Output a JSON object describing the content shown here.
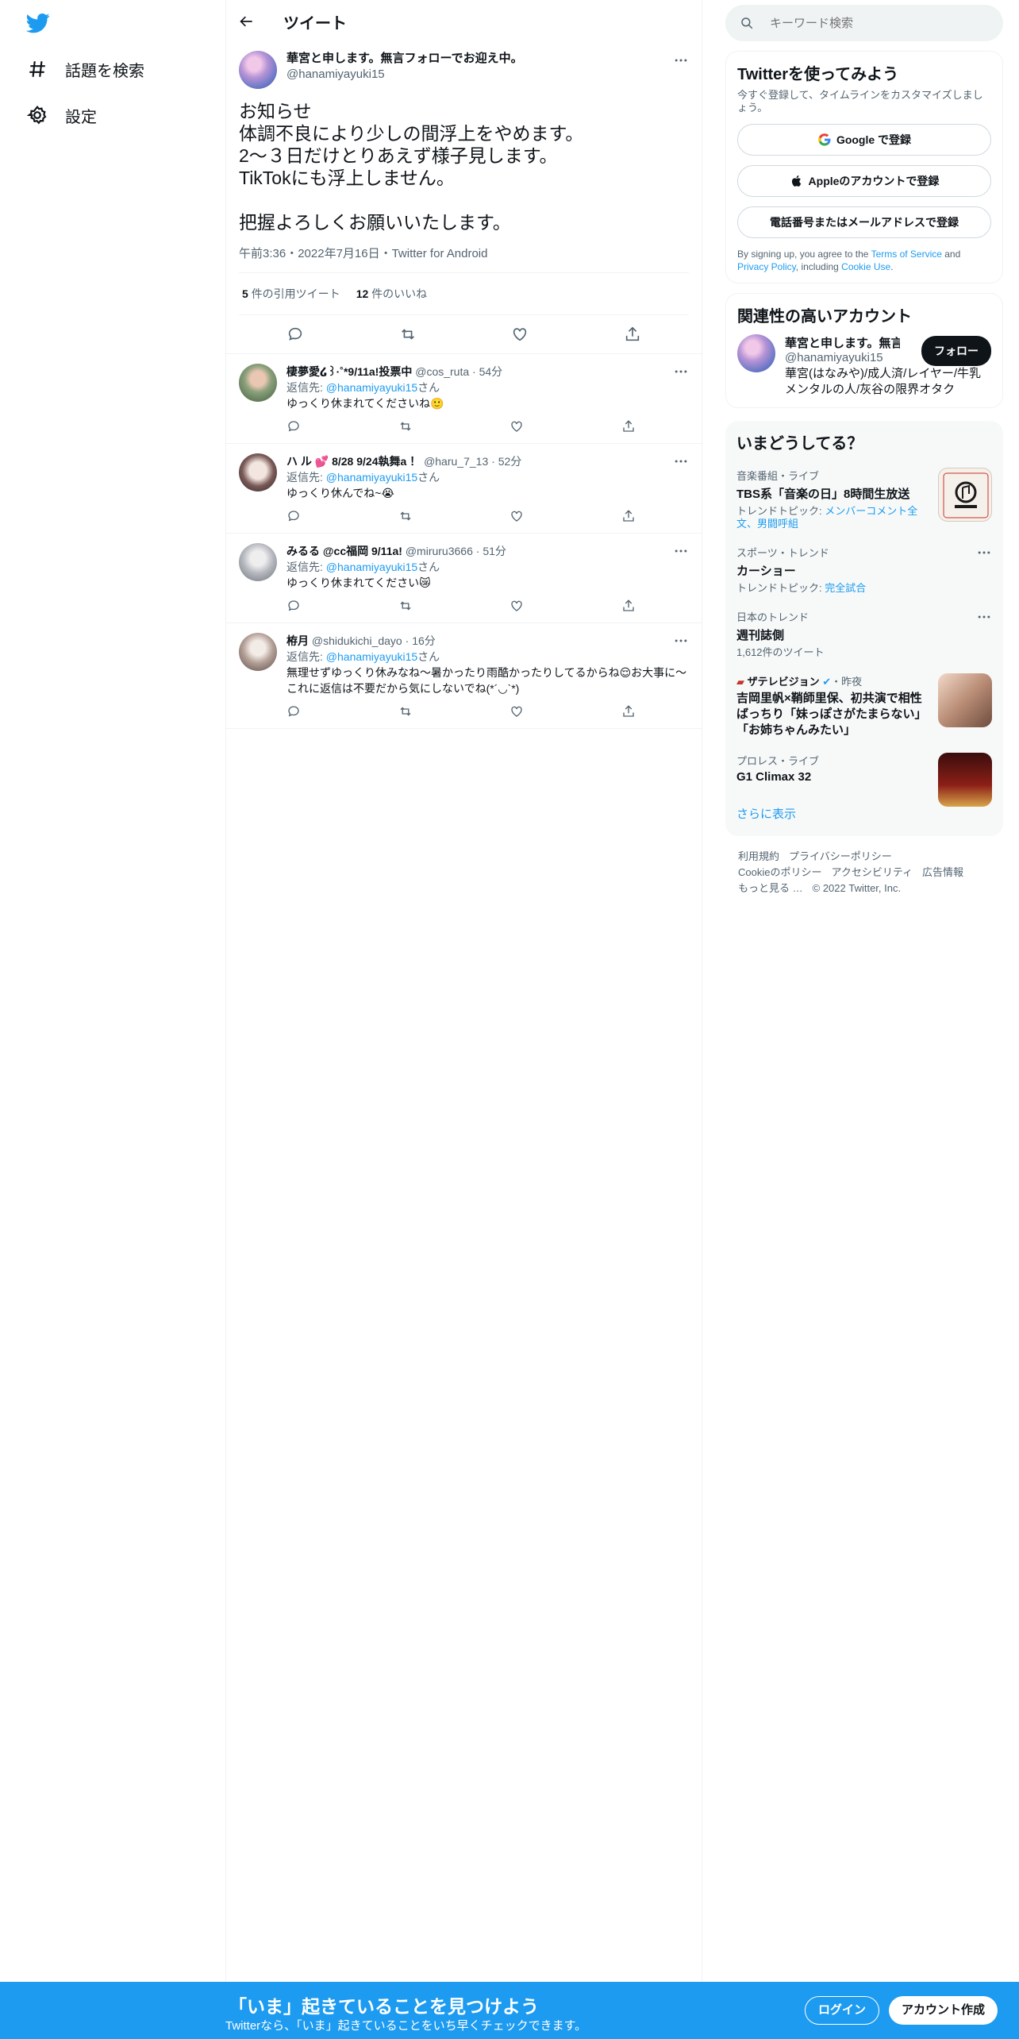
{
  "sidebar": {
    "items": [
      {
        "label": "話題を検索",
        "icon": "hashtag-icon"
      },
      {
        "label": "設定",
        "icon": "gear-icon"
      }
    ]
  },
  "header": {
    "title": "ツイート"
  },
  "tweet": {
    "name": "華宮と申します。無言フォローでお迎え中。",
    "handle": "@hanamiyayuki15",
    "text": "お知らせ\n体調不良により少しの間浮上をやめます。\n2～３日だけとりあえず様子見します。\nTikTokにも浮上しません。\n\n把握よろしくお願いいたします。",
    "meta": "午前3:36・2022年7月16日・Twitter for Android",
    "quotes_count": "5",
    "quotes_label": "件の引用ツイート",
    "likes_count": "12",
    "likes_label": "件のいいね"
  },
  "replies": [
    {
      "name": "棲夢愛໒꒱·˚*9/11a!投票中",
      "handle": "@cos_ruta",
      "time": "54分",
      "reply_to_label": "返信先:",
      "reply_to": "@hanamiyayuki15",
      "san": "さん",
      "text": "ゆっくり休まれてくださいね🙂"
    },
    {
      "name": "ハ ル 💕 8/28 9/24執舞a ！",
      "handle": "@haru_7_13",
      "time": "52分",
      "reply_to_label": "返信先:",
      "reply_to": "@hanamiyayuki15",
      "san": "さん",
      "text": "ゆっくり休んでね~😭"
    },
    {
      "name": "みるる @cc福岡 9/11a!",
      "handle": "@miruru3666",
      "time": "51分",
      "reply_to_label": "返信先:",
      "reply_to": "@hanamiyayuki15",
      "san": "さん",
      "text": "ゆっくり休まれてください😿"
    },
    {
      "name": "栫月",
      "handle": "@shidukichi_dayo",
      "time": "16分",
      "reply_to_label": "返信先:",
      "reply_to": "@hanamiyayuki15",
      "san": "さん",
      "text": "無理せずゆっくり休みなね～暑かったり雨酷かったりしてるからね😌お大事に～ これに返信は不要だから気にしないでね(*´◡`*)"
    }
  ],
  "search": {
    "placeholder": "キーワード検索"
  },
  "signup_panel": {
    "title": "Twitterを使ってみよう",
    "subtitle": "今すぐ登録して、タイムラインをカスタマイズしましょう。",
    "google": "Google で登録",
    "apple": "Appleのアカウントで登録",
    "phone": "電話番号またはメールアドレスで登録",
    "terms_1": "By signing up, you agree to the ",
    "terms_link1": "Terms of Service",
    "terms_2": " and ",
    "terms_link2": "Privacy Policy",
    "terms_3": ", including ",
    "terms_link3": "Cookie Use",
    "terms_4": "."
  },
  "relevant": {
    "title": "関連性の高いアカウント",
    "name": "華宮と申します。無言フォローでお迎え中。",
    "handle": "@hanamiyayuki15",
    "bio": "華宮(はなみや)/成人済/レイヤー/牛乳メンタルの人/灰谷の限界オタク",
    "follow": "フォロー"
  },
  "trends": {
    "title": "いまどうしてる？",
    "items": [
      {
        "category": "音楽番組・ライブ",
        "title": "TBS系「音楽の日」8時間生放送",
        "extra_label": "トレンドトピック: ",
        "extra_link": "メンバーコメント全文、男闘呼組"
      },
      {
        "category": "スポーツ・トレンド",
        "title": "カーショー",
        "extra_label": "トレンドトピック: ",
        "extra_link": "完全試合"
      },
      {
        "category": "日本のトレンド",
        "title": "週刊誌側",
        "extra_label": "1,612件のツイート",
        "extra_link": ""
      },
      {
        "category": "ザテレビジョン",
        "category_suffix": "・昨夜",
        "title": "吉岡里帆×鞘師里保、初共演で相性ばっちり「妹っぽさがたまらない」「お姉ちゃんみたい」",
        "extra_label": "",
        "extra_link": ""
      },
      {
        "category": "プロレス・ライブ",
        "title": "G1 Climax 32",
        "extra_label": "",
        "extra_link": ""
      }
    ],
    "show_more": "さらに表示"
  },
  "footer": {
    "links": [
      "利用規約",
      "プライバシーポリシー",
      "Cookieのポリシー",
      "アクセシビリティ",
      "広告情報",
      "もっと見る …"
    ],
    "copyright": "© 2022 Twitter, Inc."
  },
  "banner": {
    "title": "「いま」起きていることを見つけよう",
    "subtitle": "Twitterなら、「いま」起きていることをいち早くチェックできます。",
    "login": "ログイン",
    "signup": "アカウント作成"
  },
  "colors": {
    "accent": "#1d9bf0",
    "text": "#0f1419",
    "muted": "#536471"
  }
}
